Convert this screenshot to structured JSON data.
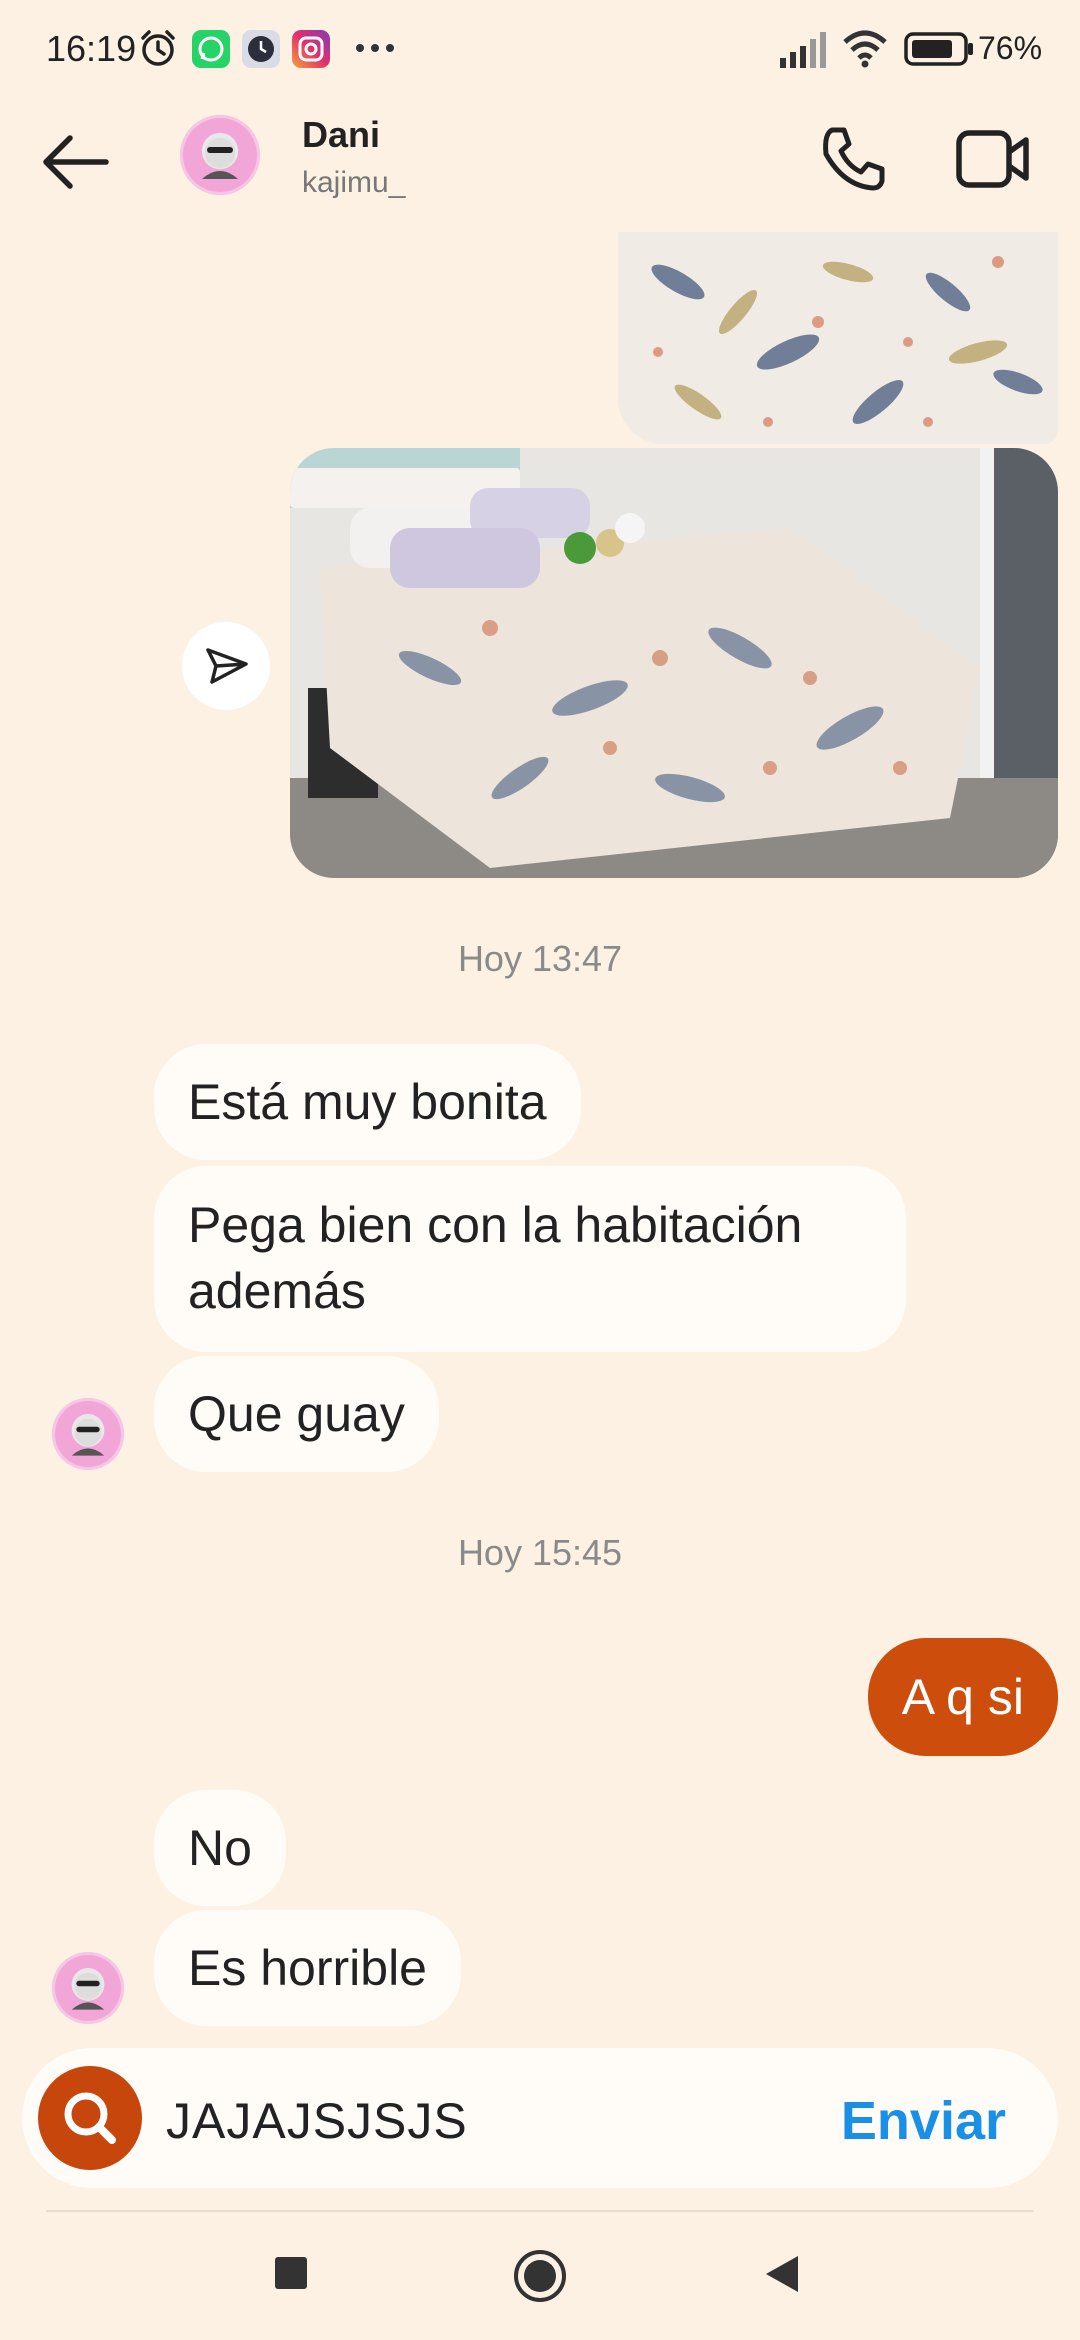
{
  "status_bar": {
    "time": "16:19",
    "battery_text": "76%",
    "notification_icons": [
      "alarm-icon",
      "whatsapp-icon",
      "clock-app-icon",
      "instagram-icon",
      "more-dots-icon"
    ],
    "system_icons": [
      "signal-icon",
      "wifi-icon",
      "battery-icon"
    ]
  },
  "header": {
    "name": "Dani",
    "handle": "kajimu_"
  },
  "messages": {
    "stamp1": "Hoy 13:47",
    "in1": "Está muy bonita",
    "in2": "Pega bien con la habitación además",
    "in3": "Que guay",
    "stamp2": "Hoy 15:45",
    "out1": "A q si",
    "in4": "No",
    "in5": "Es horrible"
  },
  "composer": {
    "value": "JAJAJSJSJS",
    "send_label": "Enviar"
  },
  "colors": {
    "background": "#fdf1e3",
    "outgoing_bubble": "#cc4d0c",
    "incoming_bubble": "#fffcf7",
    "send_text": "#1a8fe6"
  }
}
